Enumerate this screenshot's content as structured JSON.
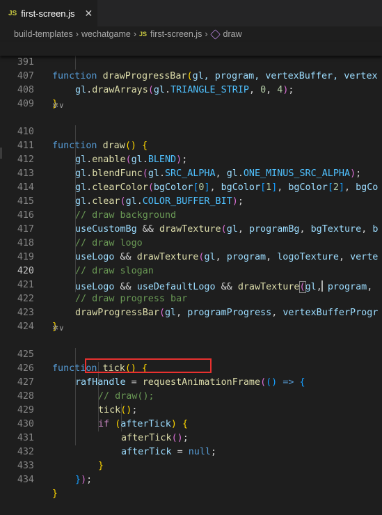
{
  "tab": {
    "badge": "JS",
    "filename": "first-screen.js",
    "close": "✕"
  },
  "breadcrumb": {
    "part1": "build-templates",
    "part2": "wechatgame",
    "badge": "JS",
    "part3": "first-screen.js",
    "part4": "draw"
  },
  "lines": {
    "n391": "391",
    "n407": "407",
    "n408": "408",
    "n409": "409",
    "n410": "410",
    "n411": "411",
    "n412": "412",
    "n413": "413",
    "n414": "414",
    "n415": "415",
    "n416": "416",
    "n417": "417",
    "n418": "418",
    "n419": "419",
    "n420": "420",
    "n421": "421",
    "n422": "422",
    "n423": "423",
    "n424": "424",
    "n425": "425",
    "n426": "426",
    "n427": "427",
    "n428": "428",
    "n429": "429",
    "n430": "430",
    "n431": "431",
    "n432": "432",
    "n433": "433",
    "n434": "434"
  },
  "code": {
    "c391a": "function",
    "c391b": "drawProgressBar",
    "c391c": "(",
    "c391d": "gl, program, vertexBuffer, vertex",
    "c407a": "gl",
    "c407b": ".",
    "c407c": "drawArrays",
    "c407d": "(",
    "c407e": "gl",
    "c407f": ".",
    "c407g": "TRIANGLE_STRIP",
    "c407h": ", ",
    "c407i": "0",
    "c407j": ", ",
    "c407k": "4",
    "c407l": ");",
    "c408": "}",
    "c410a": "function",
    "c410b": "draw",
    "c410c": "() {",
    "c411": "gl.enable(gl.BLEND);",
    "c412": "gl.blendFunc(gl.SRC_ALPHA, gl.ONE_MINUS_SRC_ALPHA);",
    "c413": "gl.clearColor(bgColor[0], bgColor[1], bgColor[2], bgCo",
    "c414": "gl.clear(gl.COLOR_BUFFER_BIT);",
    "c415": "// draw background",
    "c416": "useCustomBg && drawTexture(gl, programBg, bgTexture, b",
    "c417": "// draw logo",
    "c418": "useLogo && drawTexture(gl, program, logoTexture, verte",
    "c419": "// draw slogan",
    "c420": "useLogo && useDefaultLogo && drawTexture(gl, program, ",
    "c421": "// draw progress bar",
    "c422": "drawProgressBar(gl, programProgress, vertexBufferProgr",
    "c423": "}",
    "c425": "function tick() {",
    "c426": "rafHandle = requestAnimationFrame(() => {",
    "c427": "// draw();",
    "c428": "tick();",
    "c429": "if (afterTick) {",
    "c430": "afterTick();",
    "c431": "afterTick = null;",
    "c432": "}",
    "c433": "});",
    "c434": "}"
  },
  "codelens": {
    "l1": "✲∨",
    "l2": "✲∨"
  }
}
